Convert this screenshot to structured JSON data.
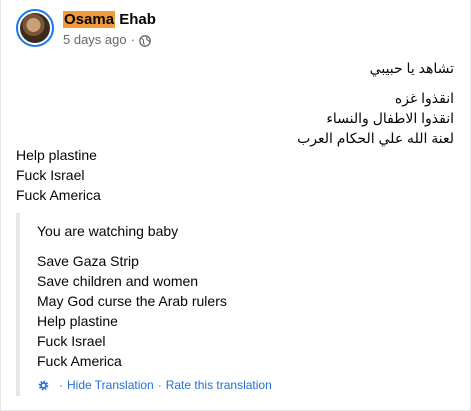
{
  "post": {
    "author_first": "Osama",
    "author_last": "Ehab",
    "time_ago": "5 days ago",
    "separator": "·",
    "privacy_icon": "globe-icon"
  },
  "content_arabic": {
    "line1": "تشاهد يا حبيبي",
    "line2": "انقذوا غزه",
    "line3": "انقذوا الاطفال والنساء",
    "line4": "لعنة الله علي الحكام العرب"
  },
  "content_english": {
    "line1": "Help plastine",
    "line2": "Fuck Israel",
    "line3": "Fuck America"
  },
  "translation": {
    "line1": "You are watching baby",
    "line2": "Save Gaza Strip",
    "line3": "Save children and women",
    "line4": "May God curse the Arab rulers",
    "line5": "Help plastine",
    "line6": "Fuck Israel",
    "line7": "Fuck America",
    "hide_label": "Hide Translation",
    "rate_label": "Rate this translation",
    "separator": "·",
    "settings_icon": "gear-icon"
  },
  "colors": {
    "link": "#216fdb",
    "highlight": "#f39a3a",
    "muted": "#65676b"
  }
}
